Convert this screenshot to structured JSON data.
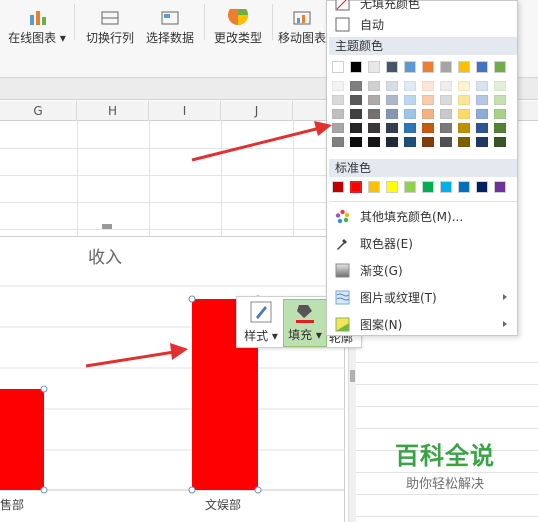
{
  "ribbon": {
    "buttons": [
      "在线图表",
      "切换行列",
      "选择数据",
      "更改类型",
      "移动图表"
    ]
  },
  "sheet": {
    "columns": [
      "G",
      "H",
      "I",
      "J"
    ]
  },
  "chart_data": {
    "type": "bar",
    "title": "收入",
    "categories": [
      "销售部",
      "文娱部"
    ],
    "category_labels_visible": [
      "销售部",
      "文娱部"
    ],
    "bar_color": "#ff0000",
    "selected_bar": "文娱部"
  },
  "chart_text": {
    "title": "收入",
    "cat1": "售部",
    "cat2": "文娱部"
  },
  "float_toolbar": {
    "style_label": "样式",
    "fill_label": "填充",
    "outline_label_partial": "轮廓"
  },
  "fill_menu": {
    "no_fill": "无填充颜色",
    "auto": "自动",
    "theme_colors_header": "主题颜色",
    "standard_colors_header": "标准色",
    "more_colors": "其他填充颜色(M)...",
    "eyedropper": "取色器(E)",
    "gradient": "渐变(G)",
    "picture_texture": "图片或纹理(T)",
    "pattern": "图案(N)",
    "theme_top_row": [
      "#ffffff",
      "#000000",
      "#e8e8e8",
      "#44546a",
      "#5b9bd5",
      "#ed7d31",
      "#a5a5a5",
      "#ffc000",
      "#4472c4",
      "#70ad47"
    ],
    "standard_colors": [
      "#c00000",
      "#ff0000",
      "#ffc000",
      "#ffff00",
      "#92d050",
      "#00b050",
      "#00b0f0",
      "#0070c0",
      "#002060",
      "#7030a0"
    ],
    "selected_standard": "#ff0000"
  },
  "watermark": {
    "title": "百科全说",
    "subtitle": "助你轻松解决"
  }
}
